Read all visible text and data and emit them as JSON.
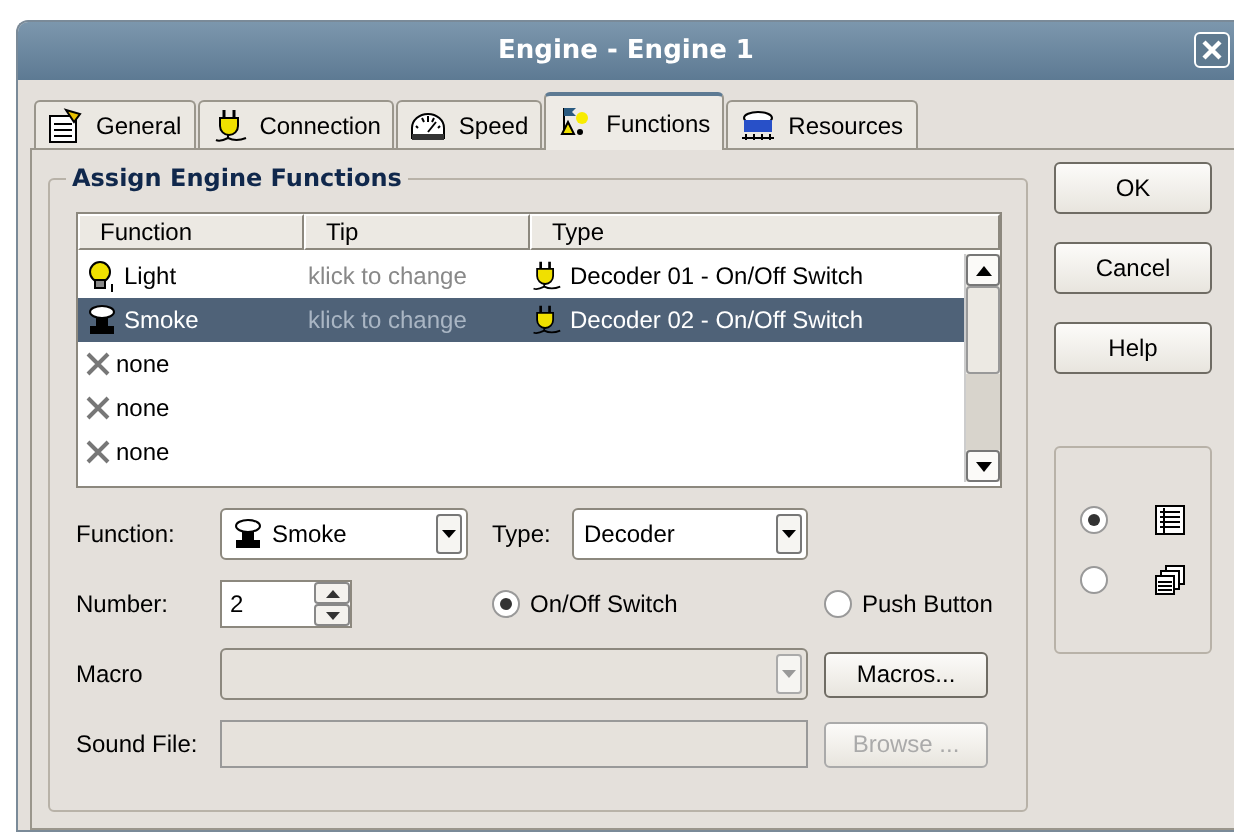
{
  "window": {
    "title": "Engine - Engine 1"
  },
  "tabs": [
    {
      "label": "General",
      "kind": "general",
      "selected": false
    },
    {
      "label": "Connection",
      "kind": "plug",
      "selected": false
    },
    {
      "label": "Speed",
      "kind": "gauge",
      "selected": false
    },
    {
      "label": "Functions",
      "kind": "functions",
      "selected": true
    },
    {
      "label": "Resources",
      "kind": "resources",
      "selected": false
    }
  ],
  "group": {
    "title": "Assign Engine Functions"
  },
  "list": {
    "columns": [
      "Function",
      "Tip",
      "Type"
    ],
    "rows": [
      {
        "function": "Light",
        "kind": "light",
        "tip": "klick to change",
        "type": "Decoder 01 - On/Off Switch",
        "selected": false
      },
      {
        "function": "Smoke",
        "kind": "smoke",
        "tip": "klick to change",
        "type": "Decoder 02 - On/Off Switch",
        "selected": true
      },
      {
        "function": "none",
        "kind": "none",
        "selected": false
      },
      {
        "function": "none",
        "kind": "none",
        "selected": false
      },
      {
        "function": "none",
        "kind": "none",
        "selected": false
      }
    ]
  },
  "form": {
    "function_label": "Function:",
    "function_value": "Smoke",
    "type_label": "Type:",
    "type_value": "Decoder",
    "number_label": "Number:",
    "number_value": "2",
    "modes": [
      {
        "label": "On/Off Switch",
        "selected": true
      },
      {
        "label": "Push Button",
        "selected": false
      }
    ],
    "macro_label": "Macro",
    "macros_button": "Macros...",
    "sound_label": "Sound File:",
    "browse_button": {
      "label": "Browse ...",
      "disabled": true
    }
  },
  "buttons": [
    "OK",
    "Cancel",
    "Help"
  ],
  "views": [
    {
      "kind": "list",
      "selected": true
    },
    {
      "kind": "windows",
      "selected": false
    }
  ]
}
